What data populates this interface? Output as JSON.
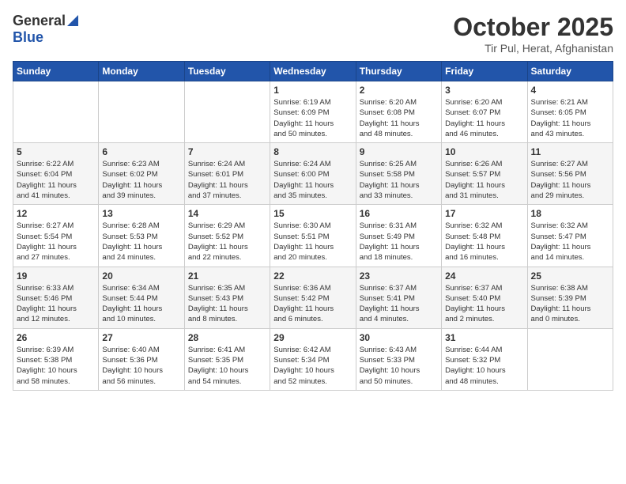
{
  "header": {
    "logo_general": "General",
    "logo_blue": "Blue",
    "month_title": "October 2025",
    "location": "Tir Pul, Herat, Afghanistan"
  },
  "days_of_week": [
    "Sunday",
    "Monday",
    "Tuesday",
    "Wednesday",
    "Thursday",
    "Friday",
    "Saturday"
  ],
  "weeks": [
    {
      "days": [
        {
          "num": "",
          "text": ""
        },
        {
          "num": "",
          "text": ""
        },
        {
          "num": "",
          "text": ""
        },
        {
          "num": "1",
          "text": "Sunrise: 6:19 AM\nSunset: 6:09 PM\nDaylight: 11 hours\nand 50 minutes."
        },
        {
          "num": "2",
          "text": "Sunrise: 6:20 AM\nSunset: 6:08 PM\nDaylight: 11 hours\nand 48 minutes."
        },
        {
          "num": "3",
          "text": "Sunrise: 6:20 AM\nSunset: 6:07 PM\nDaylight: 11 hours\nand 46 minutes."
        },
        {
          "num": "4",
          "text": "Sunrise: 6:21 AM\nSunset: 6:05 PM\nDaylight: 11 hours\nand 43 minutes."
        }
      ]
    },
    {
      "days": [
        {
          "num": "5",
          "text": "Sunrise: 6:22 AM\nSunset: 6:04 PM\nDaylight: 11 hours\nand 41 minutes."
        },
        {
          "num": "6",
          "text": "Sunrise: 6:23 AM\nSunset: 6:02 PM\nDaylight: 11 hours\nand 39 minutes."
        },
        {
          "num": "7",
          "text": "Sunrise: 6:24 AM\nSunset: 6:01 PM\nDaylight: 11 hours\nand 37 minutes."
        },
        {
          "num": "8",
          "text": "Sunrise: 6:24 AM\nSunset: 6:00 PM\nDaylight: 11 hours\nand 35 minutes."
        },
        {
          "num": "9",
          "text": "Sunrise: 6:25 AM\nSunset: 5:58 PM\nDaylight: 11 hours\nand 33 minutes."
        },
        {
          "num": "10",
          "text": "Sunrise: 6:26 AM\nSunset: 5:57 PM\nDaylight: 11 hours\nand 31 minutes."
        },
        {
          "num": "11",
          "text": "Sunrise: 6:27 AM\nSunset: 5:56 PM\nDaylight: 11 hours\nand 29 minutes."
        }
      ]
    },
    {
      "days": [
        {
          "num": "12",
          "text": "Sunrise: 6:27 AM\nSunset: 5:54 PM\nDaylight: 11 hours\nand 27 minutes."
        },
        {
          "num": "13",
          "text": "Sunrise: 6:28 AM\nSunset: 5:53 PM\nDaylight: 11 hours\nand 24 minutes."
        },
        {
          "num": "14",
          "text": "Sunrise: 6:29 AM\nSunset: 5:52 PM\nDaylight: 11 hours\nand 22 minutes."
        },
        {
          "num": "15",
          "text": "Sunrise: 6:30 AM\nSunset: 5:51 PM\nDaylight: 11 hours\nand 20 minutes."
        },
        {
          "num": "16",
          "text": "Sunrise: 6:31 AM\nSunset: 5:49 PM\nDaylight: 11 hours\nand 18 minutes."
        },
        {
          "num": "17",
          "text": "Sunrise: 6:32 AM\nSunset: 5:48 PM\nDaylight: 11 hours\nand 16 minutes."
        },
        {
          "num": "18",
          "text": "Sunrise: 6:32 AM\nSunset: 5:47 PM\nDaylight: 11 hours\nand 14 minutes."
        }
      ]
    },
    {
      "days": [
        {
          "num": "19",
          "text": "Sunrise: 6:33 AM\nSunset: 5:46 PM\nDaylight: 11 hours\nand 12 minutes."
        },
        {
          "num": "20",
          "text": "Sunrise: 6:34 AM\nSunset: 5:44 PM\nDaylight: 11 hours\nand 10 minutes."
        },
        {
          "num": "21",
          "text": "Sunrise: 6:35 AM\nSunset: 5:43 PM\nDaylight: 11 hours\nand 8 minutes."
        },
        {
          "num": "22",
          "text": "Sunrise: 6:36 AM\nSunset: 5:42 PM\nDaylight: 11 hours\nand 6 minutes."
        },
        {
          "num": "23",
          "text": "Sunrise: 6:37 AM\nSunset: 5:41 PM\nDaylight: 11 hours\nand 4 minutes."
        },
        {
          "num": "24",
          "text": "Sunrise: 6:37 AM\nSunset: 5:40 PM\nDaylight: 11 hours\nand 2 minutes."
        },
        {
          "num": "25",
          "text": "Sunrise: 6:38 AM\nSunset: 5:39 PM\nDaylight: 11 hours\nand 0 minutes."
        }
      ]
    },
    {
      "days": [
        {
          "num": "26",
          "text": "Sunrise: 6:39 AM\nSunset: 5:38 PM\nDaylight: 10 hours\nand 58 minutes."
        },
        {
          "num": "27",
          "text": "Sunrise: 6:40 AM\nSunset: 5:36 PM\nDaylight: 10 hours\nand 56 minutes."
        },
        {
          "num": "28",
          "text": "Sunrise: 6:41 AM\nSunset: 5:35 PM\nDaylight: 10 hours\nand 54 minutes."
        },
        {
          "num": "29",
          "text": "Sunrise: 6:42 AM\nSunset: 5:34 PM\nDaylight: 10 hours\nand 52 minutes."
        },
        {
          "num": "30",
          "text": "Sunrise: 6:43 AM\nSunset: 5:33 PM\nDaylight: 10 hours\nand 50 minutes."
        },
        {
          "num": "31",
          "text": "Sunrise: 6:44 AM\nSunset: 5:32 PM\nDaylight: 10 hours\nand 48 minutes."
        },
        {
          "num": "",
          "text": ""
        }
      ]
    }
  ]
}
